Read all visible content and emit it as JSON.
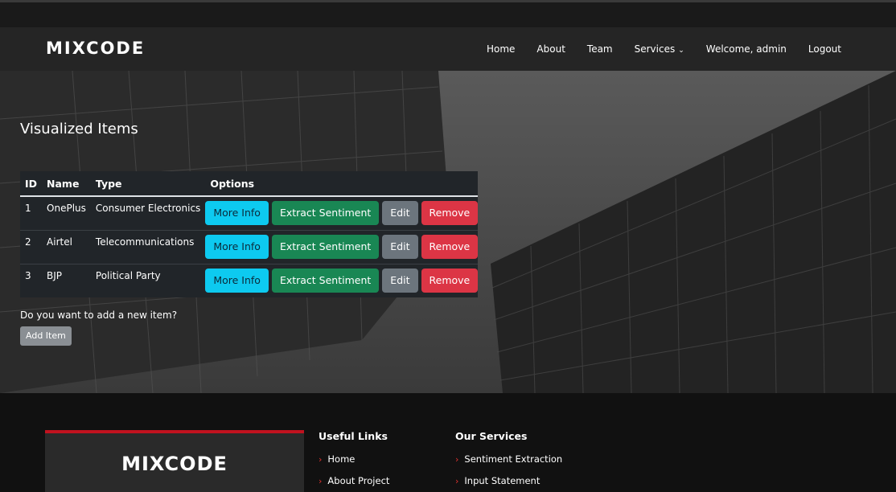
{
  "brand": "MIXCODE",
  "nav": [
    {
      "label": "Home"
    },
    {
      "label": "About"
    },
    {
      "label": "Team"
    },
    {
      "label": "Services"
    },
    {
      "label": "Welcome, admin"
    },
    {
      "label": "Logout"
    }
  ],
  "page": {
    "title": "Visualized Items",
    "table": {
      "headers": [
        "ID",
        "Name",
        "Type",
        "Options"
      ],
      "rows": [
        {
          "id": "1",
          "name": "OnePlus",
          "type": "Consumer Electronics"
        },
        {
          "id": "2",
          "name": "Airtel",
          "type": "Telecommunications"
        },
        {
          "id": "3",
          "name": "BJP",
          "type": "Political Party"
        }
      ],
      "buttons": {
        "more_info": "More Info",
        "extract": "Extract Sentiment",
        "edit": "Edit",
        "remove": "Remove"
      }
    },
    "add_prompt": "Do you want to add a new item?",
    "add_button": "Add Item"
  },
  "footer": {
    "brand": "MIXCODE",
    "useful_links": {
      "title": "Useful Links",
      "items": [
        "Home",
        "About Project"
      ]
    },
    "services": {
      "title": "Our Services",
      "items": [
        "Sentiment Extraction",
        "Input Statement"
      ]
    }
  },
  "colors": {
    "info": "#0dcaf0",
    "success": "#198754",
    "secondary": "#6c757d",
    "danger": "#dc3545",
    "footer_accent": "#c1121f"
  }
}
